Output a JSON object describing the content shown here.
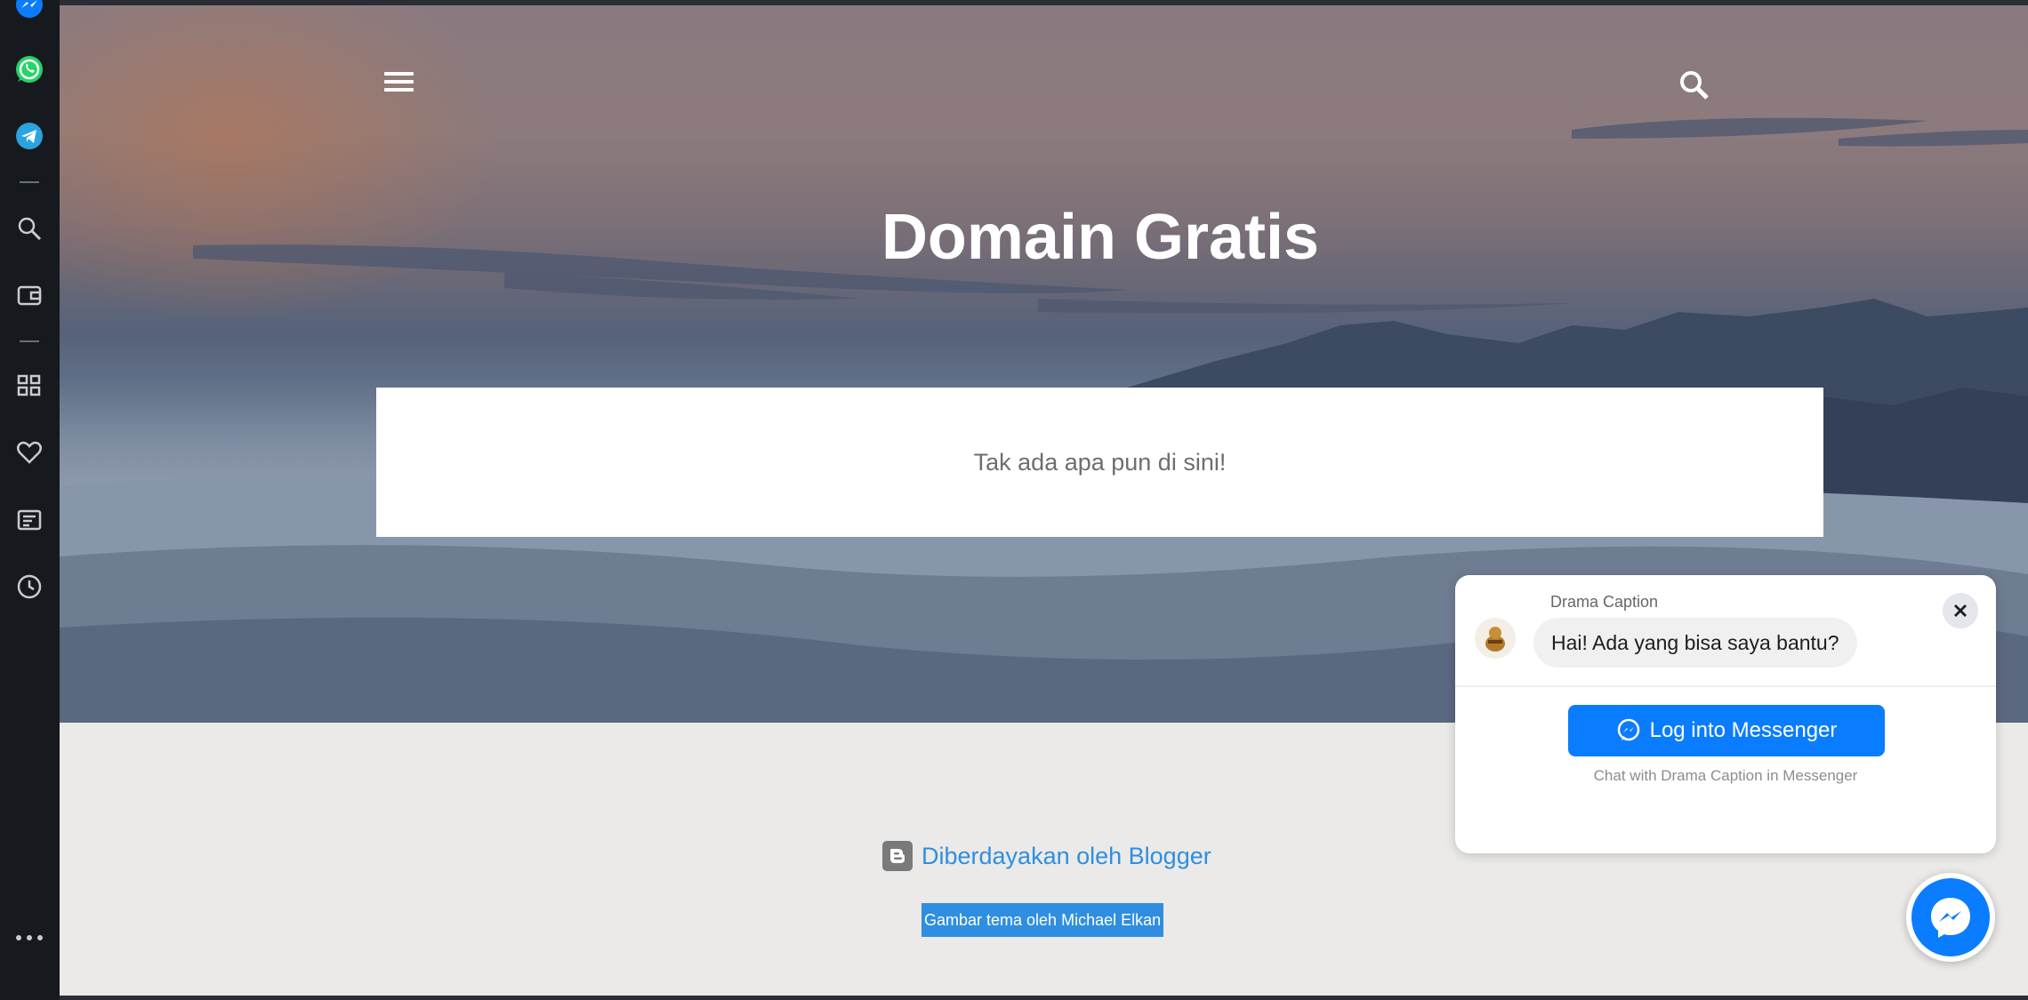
{
  "sidebar": {
    "icons": [
      "messenger-icon",
      "whatsapp-icon",
      "telegram-icon",
      "search-icon",
      "wallet-icon",
      "apps-icon",
      "heart-icon",
      "news-icon",
      "clock-icon",
      "more-icon"
    ]
  },
  "header": {
    "title": "Domain Gratis"
  },
  "main": {
    "empty_message": "Tak ada apa pun di sini!"
  },
  "footer": {
    "powered_by": "Diberdayakan oleh Blogger",
    "theme_credit": "Gambar tema oleh Michael Elkan"
  },
  "chat_widget": {
    "page_name": "Drama Caption",
    "greeting": "Hai! Ada yang bisa saya bantu?",
    "login_label": "Log into Messenger",
    "subtext": "Chat with Drama Caption in Messenger"
  },
  "colors": {
    "accent": "#0a7cff",
    "link": "#2f8ee0",
    "sidebar_bg": "#16191e",
    "page_bg": "#ebeae8"
  }
}
